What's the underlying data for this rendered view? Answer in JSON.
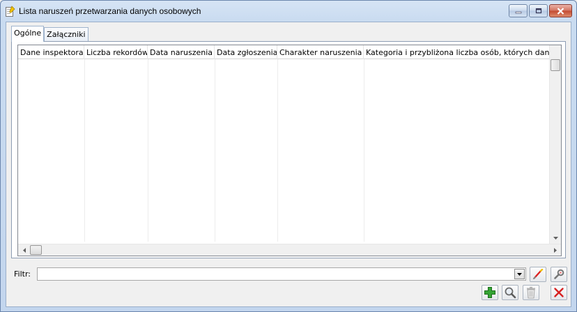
{
  "window": {
    "title": "Lista naruszeń przetwarzania danych osobowych",
    "icon": "document-pencil-icon"
  },
  "tabs": [
    {
      "label": "Ogólne",
      "active": true
    },
    {
      "label": "Załączniki",
      "active": false
    }
  ],
  "grid": {
    "columns": [
      {
        "label": "Dane inspektora",
        "align": "left"
      },
      {
        "label": "Liczba rekordów",
        "align": "right"
      },
      {
        "label": "Data naruszenia",
        "align": "right"
      },
      {
        "label": "Data zgłoszenia",
        "align": "right"
      },
      {
        "label": "Charakter naruszenia",
        "align": "left"
      },
      {
        "label": "Kategoria i przybliżona liczba osób, których dane dotyczą",
        "align": "left"
      }
    ],
    "rows": []
  },
  "filter": {
    "label": "Filtr:",
    "value": ""
  },
  "colors": {
    "add": "#2e9a2e",
    "delete": "#d32020"
  }
}
